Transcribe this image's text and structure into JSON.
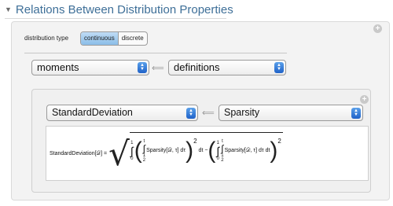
{
  "header": {
    "title": "Relations Between Distribution Properties"
  },
  "controls": {
    "distribution_type_label": "distribution type",
    "options": [
      "continuous",
      "discrete"
    ],
    "selected": "continuous"
  },
  "top_row": {
    "left": "moments",
    "arrow": "⟸",
    "right": "definitions"
  },
  "inner": {
    "left": "StandardDeviation",
    "arrow": "⟸",
    "right": "Sparsity",
    "formula": {
      "lhs": "StandardDeviation[𝒟] =",
      "term1_body": "Sparsity[𝒟, τ] dτ",
      "dt1": "dt −",
      "term2_body": "Sparsity[𝒟, τ] dτ dt",
      "int_upper": "1",
      "int_lower": "0",
      "inner_upper": "t",
      "inner_lower": "1",
      "inner_lower2": "2",
      "power": "2"
    }
  },
  "colors": {
    "title": "#3e6f98",
    "segment_on": "#8bbde8",
    "popup_arrow": "#1f62c8"
  }
}
